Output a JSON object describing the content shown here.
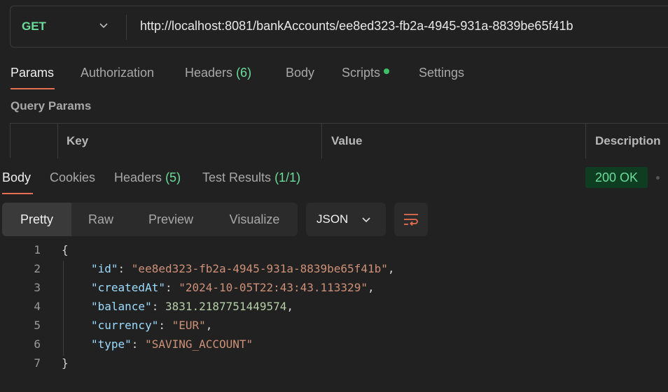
{
  "request": {
    "method": "GET",
    "url": "http://localhost:8081/bankAccounts/ee8ed323-fb2a-4945-931a-8839be65f41b"
  },
  "request_tabs": {
    "params": "Params",
    "authorization": "Authorization",
    "headers": "Headers",
    "headers_count": "(6)",
    "body": "Body",
    "scripts": "Scripts",
    "settings": "Settings"
  },
  "query_params": {
    "title": "Query Params",
    "columns": [
      "Key",
      "Value",
      "Description"
    ]
  },
  "response_tabs": {
    "body": "Body",
    "cookies": "Cookies",
    "headers": "Headers",
    "headers_count": "(5)",
    "test_results": "Test Results",
    "test_results_count": "(1/1)"
  },
  "status": "200 OK",
  "view_modes": {
    "pretty": "Pretty",
    "raw": "Raw",
    "preview": "Preview",
    "visualize": "Visualize"
  },
  "format": "JSON",
  "response_json": {
    "line_numbers": [
      "1",
      "2",
      "3",
      "4",
      "5",
      "6",
      "7"
    ],
    "open_brace": "{",
    "close_brace": "}",
    "fields": [
      {
        "key": "\"id\"",
        "value": "\"ee8ed323-fb2a-4945-931a-8839be65f41b\"",
        "type": "string",
        "comma": ","
      },
      {
        "key": "\"createdAt\"",
        "value": "\"2024-10-05T22:43:43.113329\"",
        "type": "string",
        "comma": ","
      },
      {
        "key": "\"balance\"",
        "value": "3831.2187751449574",
        "type": "number",
        "comma": ","
      },
      {
        "key": "\"currency\"",
        "value": "\"EUR\"",
        "type": "string",
        "comma": ","
      },
      {
        "key": "\"type\"",
        "value": "\"SAVING_ACCOUNT\"",
        "type": "string",
        "comma": ""
      }
    ]
  },
  "colors": {
    "method_get": "#6bdd9a",
    "active_underline": "#e76f51",
    "status_bg": "#0f3d22",
    "json_key": "#9cdcfe",
    "json_string": "#ce9178",
    "json_number": "#b5cea8"
  },
  "icons": [
    "chevron-down-icon",
    "status-dot-icon",
    "wrap-lines-icon"
  ]
}
